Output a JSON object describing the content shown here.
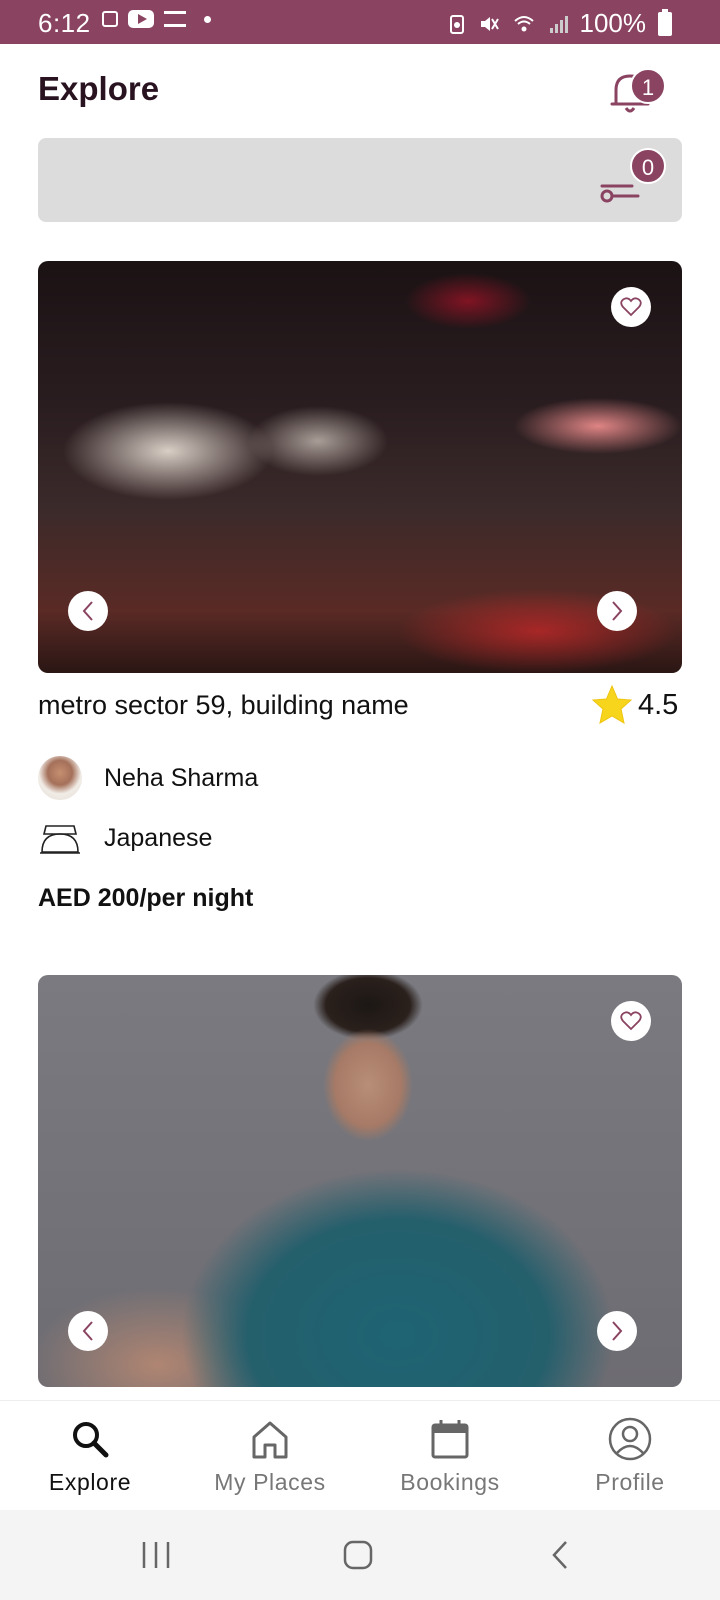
{
  "status_bar": {
    "time": "6:12",
    "battery": "100%",
    "color": "#8a4360"
  },
  "header": {
    "title": "Explore",
    "notification_count": "1"
  },
  "search": {
    "filter_count": "0"
  },
  "listings": [
    {
      "title": "metro sector 59, building name",
      "rating": "4.5",
      "host": "Neha Sharma",
      "cuisine": "Japanese",
      "price": "AED 200/per night",
      "image": "restaurant-interior-photo"
    },
    {
      "image": "man-in-teal-shirt-photo"
    }
  ],
  "bottom_nav": {
    "tabs": [
      {
        "label": "Explore",
        "icon": "search-icon",
        "active": true
      },
      {
        "label": "My Places",
        "icon": "home-icon",
        "active": false
      },
      {
        "label": "Bookings",
        "icon": "calendar-icon",
        "active": false
      },
      {
        "label": "Profile",
        "icon": "profile-icon",
        "active": false
      }
    ]
  },
  "colors": {
    "brand": "#8a4360",
    "search_bg": "#dddcdd",
    "rating_star": "#f7d51d"
  }
}
